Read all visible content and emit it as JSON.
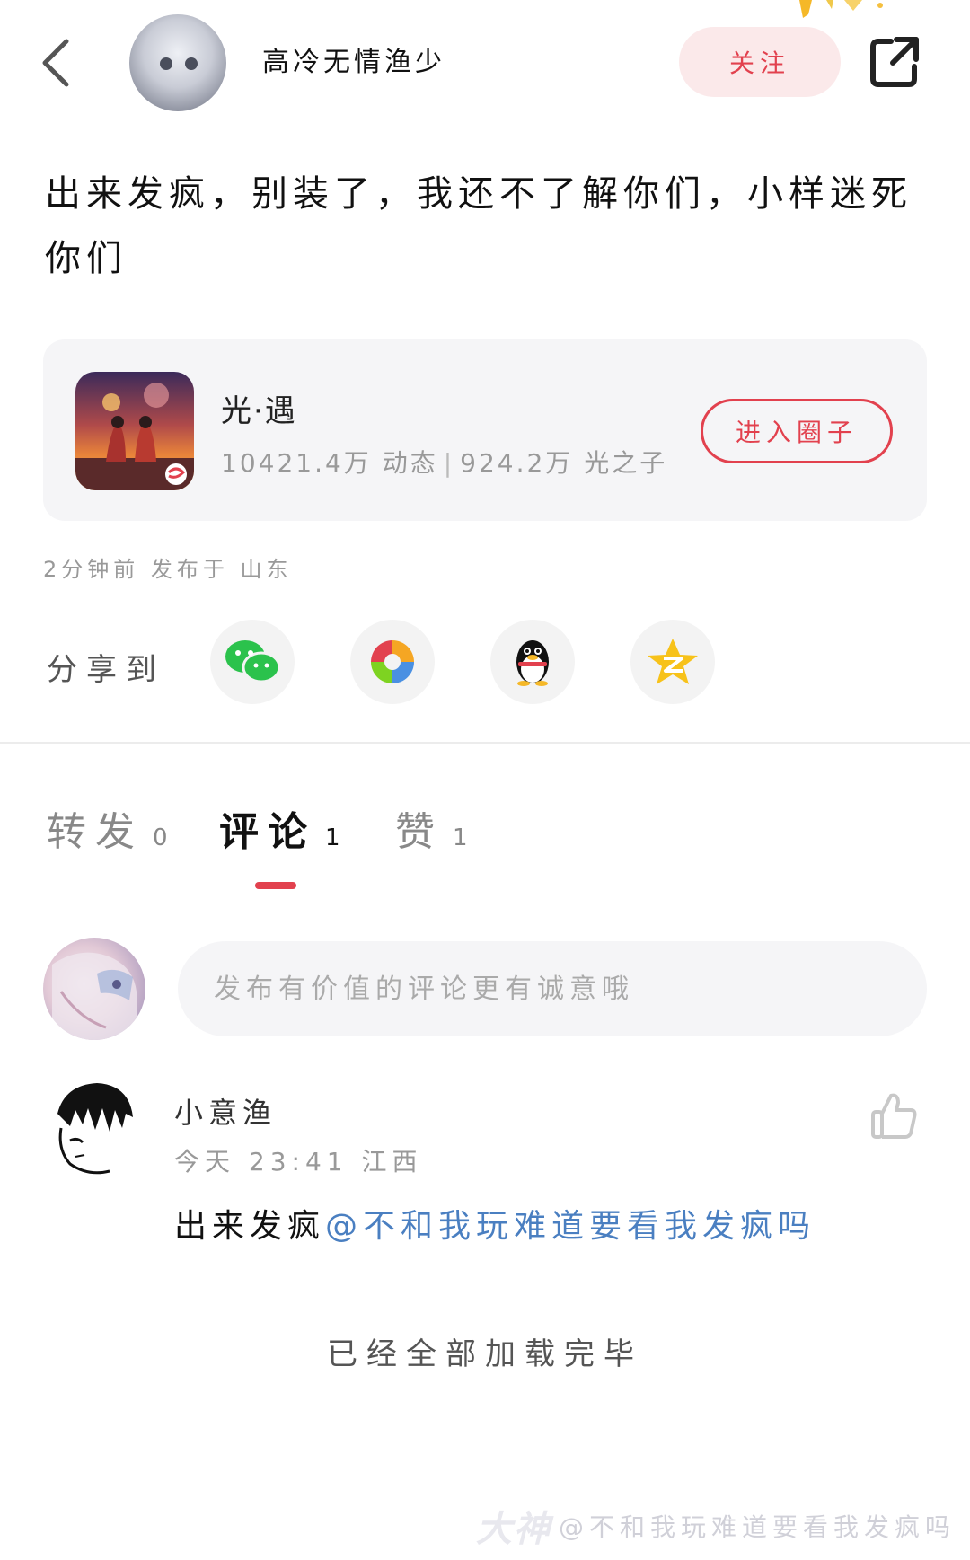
{
  "header": {
    "username": "高冷无情渔少",
    "follow_label": "关注"
  },
  "post": {
    "text": "出来发疯，别装了，我还不了解你们，小样迷死你们",
    "meta": "2分钟前 发布于 山东"
  },
  "circle": {
    "name": "光·遇",
    "posts": "10421.4万 动态",
    "members": "924.2万 光之子",
    "enter_label": "进入圈子"
  },
  "share": {
    "label": "分享到",
    "targets": [
      "wechat-icon",
      "moments-icon",
      "qq-icon",
      "qzone-icon"
    ]
  },
  "tabs": [
    {
      "label": "转发",
      "count": "0"
    },
    {
      "label": "评论",
      "count": "1"
    },
    {
      "label": "赞",
      "count": "1"
    }
  ],
  "active_tab": 1,
  "compose": {
    "placeholder": "发布有价值的评论更有诚意哦"
  },
  "comments": [
    {
      "author": "小意渔",
      "time": "今天 23:41  江西",
      "text": "出来发疯",
      "mention": "@不和我玩难道要看我发疯吗"
    }
  ],
  "footer": {
    "end_text": "已经全部加载完毕"
  },
  "watermark": {
    "logo": "大神",
    "text": "@不和我玩难道要看我发疯吗"
  },
  "colors": {
    "accent": "#e2414e",
    "mention": "#4a7fc1",
    "card_bg": "#f5f5f7"
  }
}
